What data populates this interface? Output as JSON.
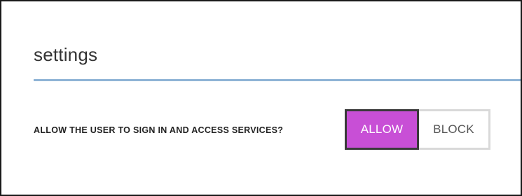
{
  "settings": {
    "title": "settings",
    "question": "ALLOW THE USER TO SIGN IN AND ACCESS SERVICES?",
    "options": [
      {
        "label": "ALLOW",
        "selected": true
      },
      {
        "label": "BLOCK",
        "selected": false
      }
    ]
  },
  "colors": {
    "selected_bg": "#c84fd6",
    "rule": "#8fb4d6"
  }
}
